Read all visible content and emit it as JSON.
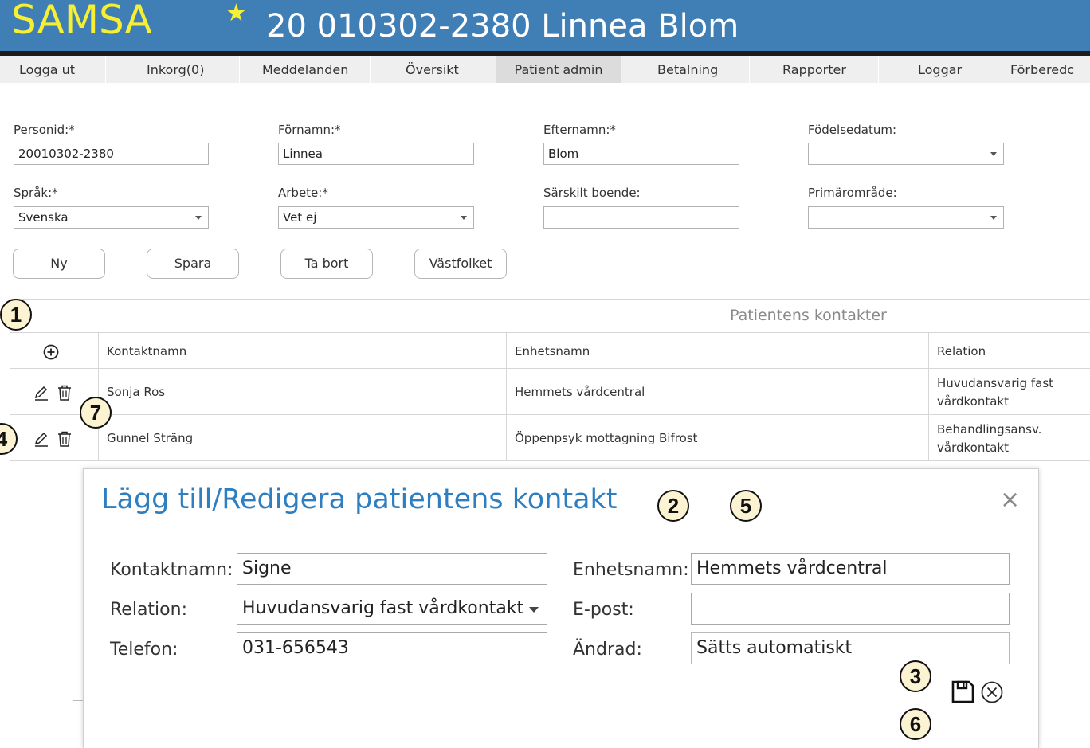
{
  "header": {
    "logo": "SAMSA",
    "patient_title": "20 010302-2380 Linnea Blom",
    "star_icon": "star-icon"
  },
  "nav": {
    "items": [
      "Logga ut",
      "Inkorg(0)",
      "Meddelanden",
      "Översikt",
      "Patient admin",
      "Betalning",
      "Rapporter",
      "Loggar",
      "Förberedc"
    ],
    "active": "Patient admin"
  },
  "form": {
    "personid": {
      "label": "Personid:*",
      "value": "20010302-2380"
    },
    "fornamn": {
      "label": "Förnamn:*",
      "value": "Linnea"
    },
    "efternamn": {
      "label": "Efternamn:*",
      "value": "Blom"
    },
    "fodelsedatum": {
      "label": "Födelsedatum:",
      "value": ""
    },
    "sprak": {
      "label": "Språk:*",
      "value": "Svenska"
    },
    "arbete": {
      "label": "Arbete:*",
      "value": "Vet ej"
    },
    "sarskilt_boende": {
      "label": "Särskilt boende:",
      "value": ""
    },
    "primaromrade": {
      "label": "Primärområde:",
      "value": ""
    }
  },
  "buttons": {
    "ny": "Ny",
    "spara": "Spara",
    "ta_bort": "Ta bort",
    "vastfolket": "Västfolket"
  },
  "contacts": {
    "section_title": "Patientens kontakter",
    "columns": [
      "Kontaktnamn",
      "Enhetsnamn",
      "Relation"
    ],
    "rows": [
      {
        "name": "Sonja Ros",
        "unit": "Hemmets vårdcentral",
        "relation_line1": "Huvudansvarig fast",
        "relation_line2": "vårdkontakt"
      },
      {
        "name": "Gunnel Sträng",
        "unit": "Öppenpsyk mottagning Bifrost",
        "relation_line1": "Behandlingsansv.",
        "relation_line2": "vårdkontakt"
      }
    ]
  },
  "dialog": {
    "title": "Lägg till/Redigera patientens kontakt",
    "close": "×",
    "fields": {
      "kontaktnamn": {
        "label": "Kontaktnamn:",
        "value": "Signe"
      },
      "relation": {
        "label": "Relation:",
        "value": "Huvudansvarig fast vårdkontakt"
      },
      "telefon": {
        "label": "Telefon:",
        "value": "031-656543"
      },
      "enhetsnamn": {
        "label": "Enhetsnamn:",
        "value": "Hemmets vårdcentral"
      },
      "epost": {
        "label": "E-post:",
        "value": ""
      },
      "andrad": {
        "label": "Ändrad:",
        "value": "Sätts automatiskt"
      }
    }
  },
  "callouts": [
    "1",
    "2",
    "3",
    "4",
    "5",
    "6",
    "7"
  ],
  "colors": {
    "header_bg": "#3f7fb5",
    "logo": "#f6ef33",
    "dialog_title": "#2e7fc1",
    "callout_bg": "#fcf3d2"
  }
}
